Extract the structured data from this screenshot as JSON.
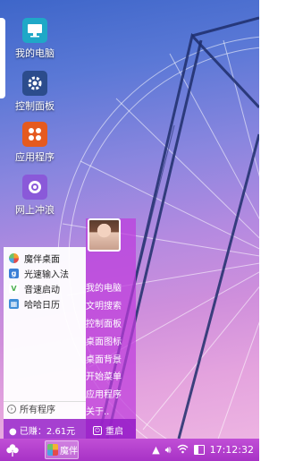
{
  "desktop": {
    "icons": [
      {
        "label": "我的电脑",
        "icon": "monitor-icon",
        "color": "#1fa8c7"
      },
      {
        "label": "控制面板",
        "icon": "gear-icon",
        "color": "#2c4c8c"
      },
      {
        "label": "应用程序",
        "icon": "apps-icon",
        "color": "#e55a1f"
      },
      {
        "label": "网上冲浪",
        "icon": "browser-icon",
        "color": "#8a59d9"
      }
    ]
  },
  "start_menu": {
    "apps": [
      {
        "label": "魔伴桌面",
        "icon": "magic-desktop-icon",
        "color": "#f2a12f"
      },
      {
        "label": "光速输入法",
        "icon": "input-method-icon",
        "color": "#3a7fd6"
      },
      {
        "label": "音速启动",
        "icon": "v-launch-icon",
        "color": "#4caf50"
      },
      {
        "label": "哈哈日历",
        "icon": "calendar-icon",
        "color": "#3f8fd8"
      }
    ],
    "all_programs": "所有程序",
    "links": [
      "我的电脑",
      "文明搜索",
      "控制面板",
      "桌面图标",
      "桌面背景",
      "开始菜单",
      "应用程序",
      "关于.."
    ],
    "earned": "已赚：2.61元",
    "restart": "重启"
  },
  "taskbar": {
    "task_label": "魔伴",
    "time": "17:12:32",
    "colors": {
      "bar": "#b53ecd",
      "menu_panel": "#c04ddb"
    }
  }
}
